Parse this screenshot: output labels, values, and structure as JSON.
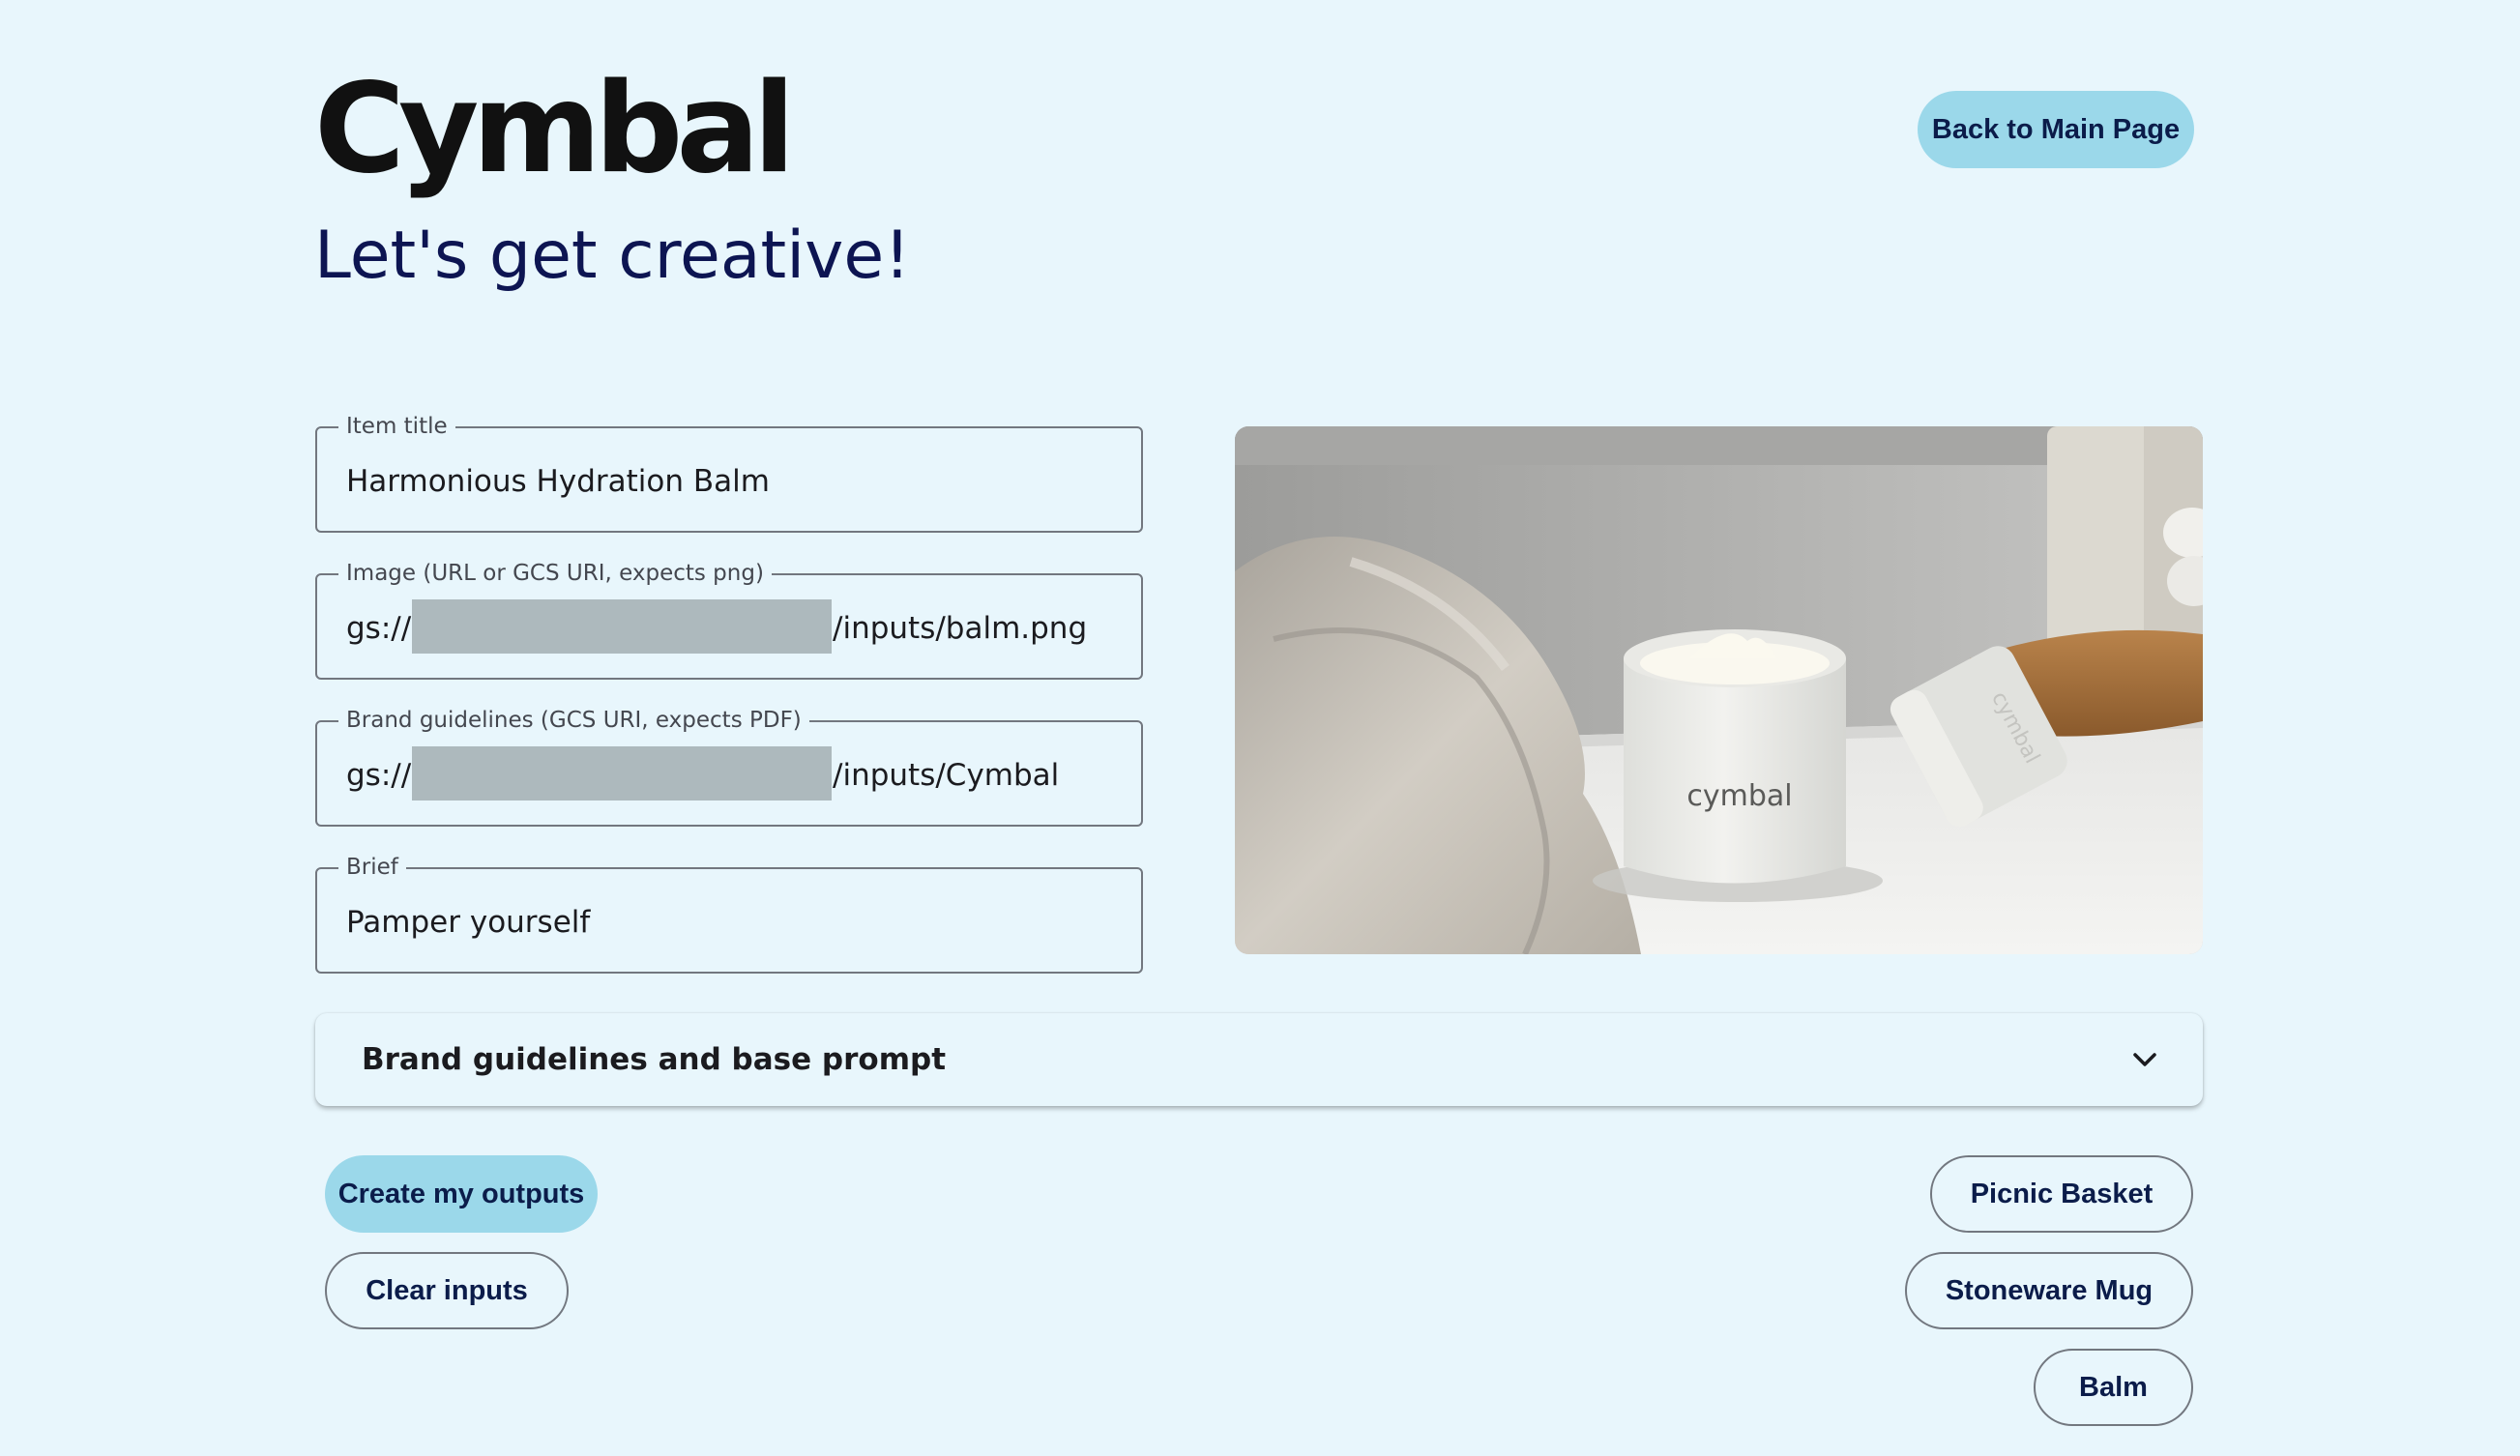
{
  "header": {
    "logo_text": "Cymbal",
    "back_button_label": "Back to Main Page",
    "headline": "Let's get creative!"
  },
  "form": {
    "item_title": {
      "label": "Item title",
      "value": "Harmonious Hydration Balm"
    },
    "image": {
      "label": "Image (URL or GCS URI, expects png)",
      "value": "gs:// /inputs/balm.png"
    },
    "brand_guidelines": {
      "label": "Brand guidelines (GCS URI, expects PDF)",
      "value": "gs:// /inputs/Cymbal Bra"
    },
    "brief": {
      "label": "Brief",
      "value": "Pamper yourself"
    }
  },
  "preview": {
    "jar_label": "cymbal",
    "lid_label": "cymbal"
  },
  "expander": {
    "title": "Brand guidelines and base prompt",
    "expanded": false
  },
  "actions": {
    "create_label": "Create my outputs",
    "clear_label": "Clear inputs"
  },
  "samples": [
    {
      "label": "Picnic Basket"
    },
    {
      "label": "Stoneware Mug"
    },
    {
      "label": "Balm"
    }
  ],
  "colors": {
    "background": "#e8f6fc",
    "accent_button": "#9bd8ea",
    "headline": "#0d1552",
    "field_border": "#72777f",
    "redaction": "#adb9bd"
  }
}
